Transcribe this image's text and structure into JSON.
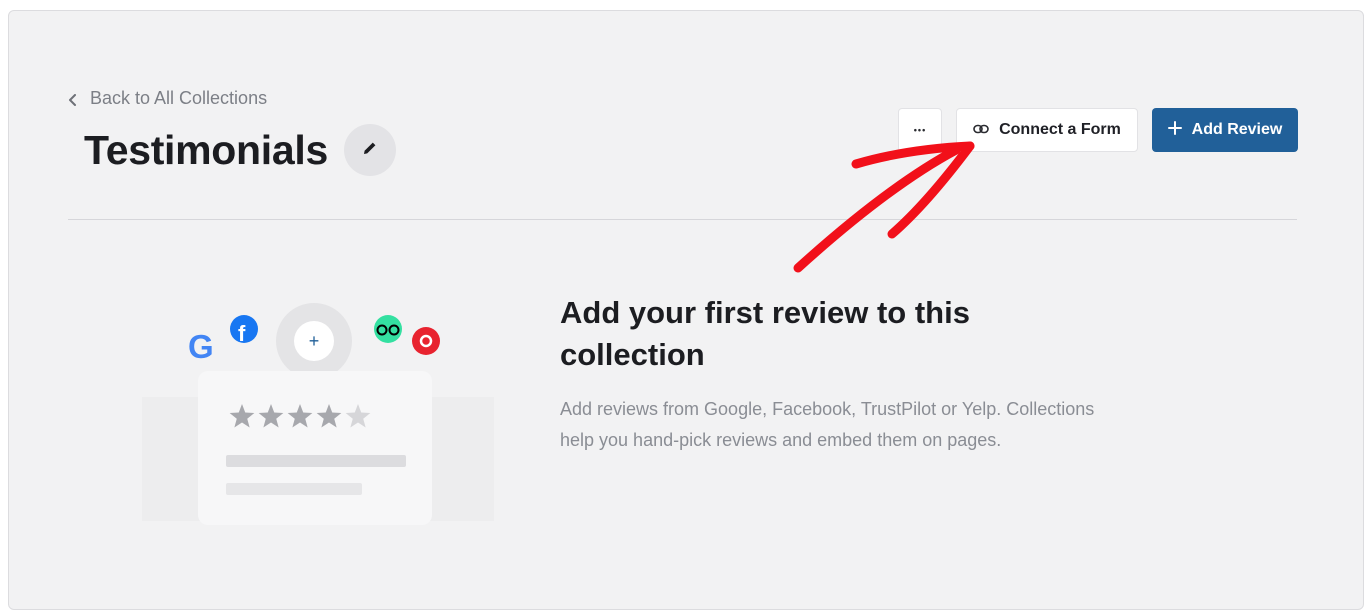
{
  "header": {
    "back_label": "Back to All Collections",
    "title": "Testimonials"
  },
  "toolbar": {
    "more_label": "•••",
    "connect_label": "Connect a Form",
    "add_label": "Add Review"
  },
  "empty_state": {
    "title": "Add your first review to this collection",
    "description": "Add reviews from Google, Facebook, TrustPilot or Yelp. Collections help you hand-pick reviews and embed them on pages.",
    "add_symbol": "+",
    "rating_filled": 4,
    "rating_max": 5
  },
  "icons": {
    "platforms": [
      "google-icon",
      "facebook-icon",
      "tripadvisor-icon",
      "yelp-icon"
    ]
  },
  "colors": {
    "primary": "#216099",
    "annotation": "#f2101a",
    "facebook": "#1877f2",
    "tripadvisor": "#34e0a1",
    "yelp": "#e8232f"
  }
}
